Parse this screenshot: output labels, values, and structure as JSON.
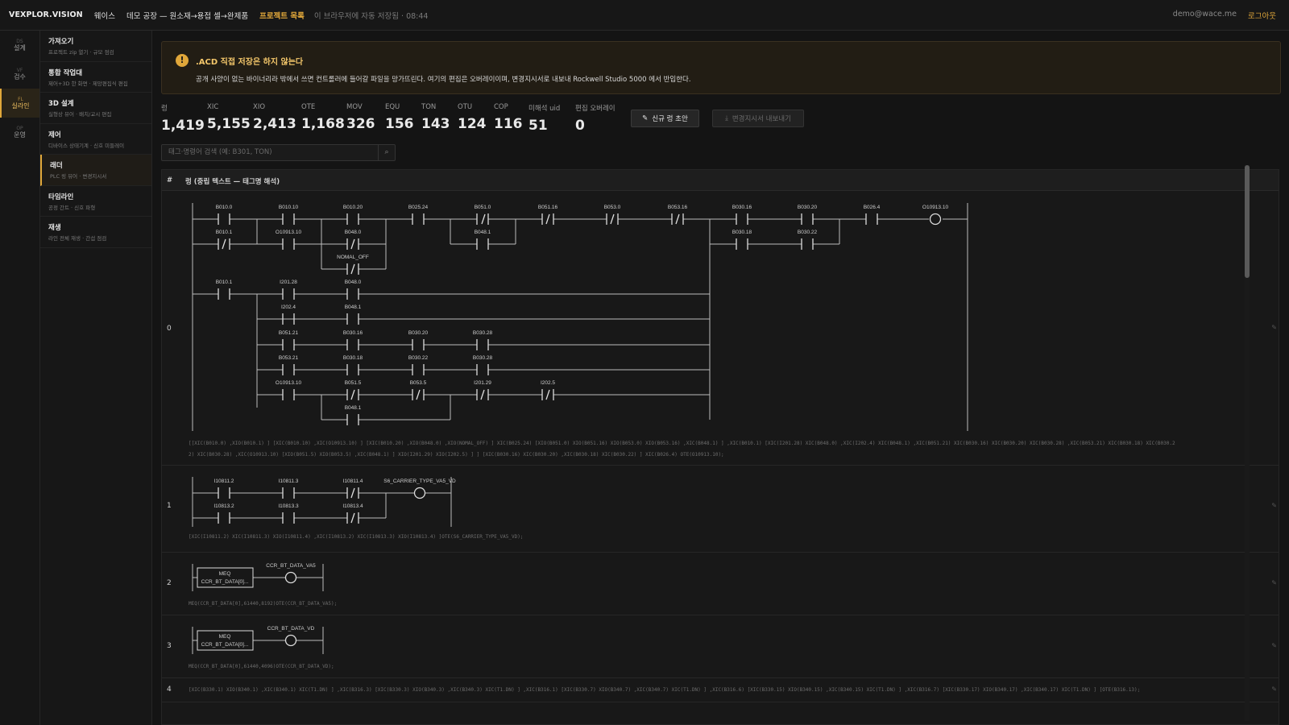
{
  "topbar": {
    "logo": "VEXPLOR.VISION",
    "crumb1": "웨이스",
    "crumb2": "데모 공장 — 원소재→용접 셀→완제품",
    "project_list": "프로젝트 목록",
    "saved": "이 브라우저에 자동 저장됨 · 08:44",
    "email": "demo@wace.me",
    "logout": "로그아웃"
  },
  "rail": [
    {
      "abbr": "DS",
      "label": "설계"
    },
    {
      "abbr": "VF",
      "label": "검수"
    },
    {
      "abbr": "FL",
      "label": "실라인"
    },
    {
      "abbr": "OP",
      "label": "운영"
    }
  ],
  "sidebar": [
    {
      "title": "가져오기",
      "desc": "프로젝트 zip 열기 · 규모 점검"
    },
    {
      "title": "통합 작업대",
      "desc": "제어+3D 한 화면 · 제앙편집식 편집"
    },
    {
      "title": "3D 설계",
      "desc": "실형상 뷰어 · 배치/교시 편집"
    },
    {
      "title": "제어",
      "desc": "디바이스 상태기계 · 신호 미들레이"
    },
    {
      "title": "래더",
      "desc": "PLC 링 뷰어 · 변경지시서"
    },
    {
      "title": "타임라인",
      "desc": "공정 간트 · 신호 파형"
    },
    {
      "title": "재생",
      "desc": "라인 전체 재생 · 간섭 점검"
    }
  ],
  "warning": {
    "icon": "!",
    "title": ".ACD 직접 저장은 하지 않는다",
    "body": "공개 사양이 없는 바이너리라 밖에서 쓰면 컨트롤러에 들어갈 파일을 망가뜨린다. 여기의 편집은 오버레이이며, 변경지시서로 내보내 Rockwell Studio 5000 에서 반입한다."
  },
  "stats": [
    {
      "label": "렁",
      "value": "1,419"
    },
    {
      "label": "XIC",
      "value": "5,155"
    },
    {
      "label": "XIO",
      "value": "2,413"
    },
    {
      "label": "OTE",
      "value": "1,168"
    },
    {
      "label": "MOV",
      "value": "326"
    },
    {
      "label": "EQU",
      "value": "156"
    },
    {
      "label": "TON",
      "value": "143"
    },
    {
      "label": "OTU",
      "value": "124"
    },
    {
      "label": "COP",
      "value": "116"
    },
    {
      "label": "미해석 uid",
      "value": "51"
    },
    {
      "label": "편집 오버레이",
      "value": "0"
    }
  ],
  "buttons": {
    "new_rung": "신규 렁 초안",
    "export": "변경지시서 내보내기"
  },
  "search": {
    "placeholder": "태그·명령어 검색 (예: B301, TON)"
  },
  "panel_header": {
    "num": "#",
    "title": "렁 (중립 텍스트 — 태그명 해석)"
  },
  "rungs": [
    {
      "num": "0",
      "text": "[[XIC(B010.0) ,XIO(B010.1) ] [XIC(B010.10) ,XIC(O10913.10) ] [XIC(B010.20) ,XIO(B048.0) ,XIO(NOMAL_OFF) ] XIC(B025.24) [XIO(B051.0) XIO(B051.16) XIO(B053.0) XIO(B053.16) ,XIC(B048.1) ] ,XIC(B010.1) [XIC(I201.28) XIC(B048.0) ,XIC(I202.4) XIC(B048.1) ,XIC(B051.21) XIC(B030.16) XIC(B030.20) XIC(B030.28) ,XIC(B053.21) XIC(B030.18) XIC(B030.2",
      "text2": "2) XIC(B030.28) ,XIC(O10913.10) [XIO(B051.5) XIO(B053.5) ,XIC(B048.1) ] XIO(I201.29) XIO(I202.5) ] ] [XIC(B030.16) XIC(B030.20) ,XIC(B030.18) XIC(B030.22) ] XIC(B026.4) OTE(O10913.10);",
      "labels": [
        "B010.0",
        "B010.10",
        "B010.20",
        "B025.24",
        "B051.0",
        "B051.16",
        "B053.0",
        "B053.16",
        "B030.16",
        "B030.20",
        "B026.4",
        "O10913.10",
        "B010.1",
        "O10913.10",
        "B048.0",
        "B048.1",
        "B030.18",
        "B030.22",
        "NOMAL_OFF",
        "B010.1",
        "I201.28",
        "B048.0",
        "I202.4",
        "B048.1",
        "B051.21",
        "B030.16",
        "B030.20",
        "B030.28",
        "B053.21",
        "B030.18",
        "B030.22",
        "B030.28",
        "O10913.10",
        "B051.5",
        "B053.5",
        "I201.29",
        "I202.5",
        "B048.1"
      ]
    },
    {
      "num": "1",
      "text": "[XIC(I10811.2) XIC(I10811.3) XIO(I10811.4) ,XIC(I10813.2) XIC(I10813.3) XIO(I10813.4) ]OTE(S6_CARRIER_TYPE_VA5_VD);",
      "labels": [
        "I10811.2",
        "I10811.3",
        "I10811.4",
        "S6_CARRIER_TYPE_VA5_VD",
        "I10813.2",
        "I10813.3",
        "I10813.4"
      ]
    },
    {
      "num": "2",
      "text": "MEQ(CCR_BT_DATA[0],61440,8192)OTE(CCR_BT_DATA_VA5);",
      "labels": [
        "MEQ",
        "CCR_BT_DATA[0]...",
        "CCR_BT_DATA_VA5"
      ]
    },
    {
      "num": "3",
      "text": "MEQ(CCR_BT_DATA[0],61440,4096)OTE(CCR_BT_DATA_VD);",
      "labels": [
        "MEQ",
        "CCR_BT_DATA[0]...",
        "CCR_BT_DATA_VD"
      ]
    },
    {
      "num": "4",
      "text": "[XIC(B330.1) XIO(B340.1) ,XIC(B340.1) XIC(T1.DN) ] ,XIC(B316.3) [XIC(B330.3) XIO(B340.3) ,XIC(B340.3) XIC(T1.DN) ] ,XIC(B316.1) [XIC(B330.7) XIO(B340.7) ,XIC(B340.7) XIC(T1.DN) ] ,XIC(B316.6) [XIC(B330.15) XIO(B340.15) ,XIC(B340.15) XIC(T1.DN) ] ,XIC(B316.7) [XIC(B330.17) XIO(B340.17) ,XIC(B340.17) XIC(T1.DN) ] [OTE(B316.13);"
    }
  ]
}
